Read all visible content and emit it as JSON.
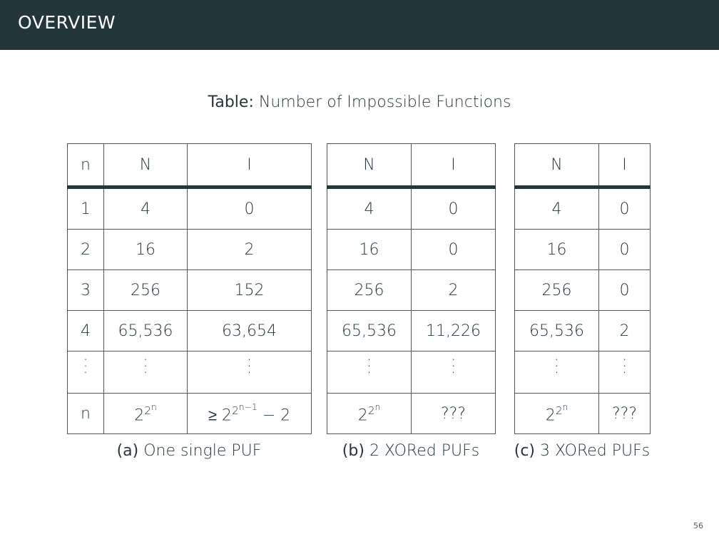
{
  "header": {
    "title": "OVERVIEW"
  },
  "table_caption": {
    "label": "Table:",
    "text": "Number of Impossible Functions"
  },
  "tables": [
    {
      "headers": [
        "n",
        "N",
        "I"
      ],
      "rows": [
        [
          "1",
          "4",
          "0"
        ],
        [
          "2",
          "16",
          "2"
        ],
        [
          "3",
          "256",
          "152"
        ],
        [
          "4",
          "65,536",
          "63,654"
        ]
      ],
      "last_row": {
        "n": "n",
        "N_base": "2",
        "N_exp_base": "2",
        "N_exp": "n",
        "I_prefix": "≥ 2",
        "I_exp_base": "2",
        "I_exp": "n−1",
        "I_suffix": " − 2"
      },
      "caption_label": "(a)",
      "caption_text": "One single PUF"
    },
    {
      "headers": [
        "N",
        "I"
      ],
      "rows": [
        [
          "4",
          "0"
        ],
        [
          "16",
          "0"
        ],
        [
          "256",
          "2"
        ],
        [
          "65,536",
          "11,226"
        ]
      ],
      "last_row": {
        "N_base": "2",
        "N_exp_base": "2",
        "N_exp": "n",
        "I": "???"
      },
      "caption_label": "(b)",
      "caption_text": "2 XORed PUFs"
    },
    {
      "headers": [
        "N",
        "I"
      ],
      "rows": [
        [
          "4",
          "0"
        ],
        [
          "16",
          "0"
        ],
        [
          "256",
          "0"
        ],
        [
          "65,536",
          "2"
        ]
      ],
      "last_row": {
        "N_base": "2",
        "N_exp_base": "2",
        "N_exp": "n",
        "I": "???"
      },
      "caption_label": "(c)",
      "caption_text": "3 XORed PUFs"
    }
  ],
  "page_number": "56"
}
